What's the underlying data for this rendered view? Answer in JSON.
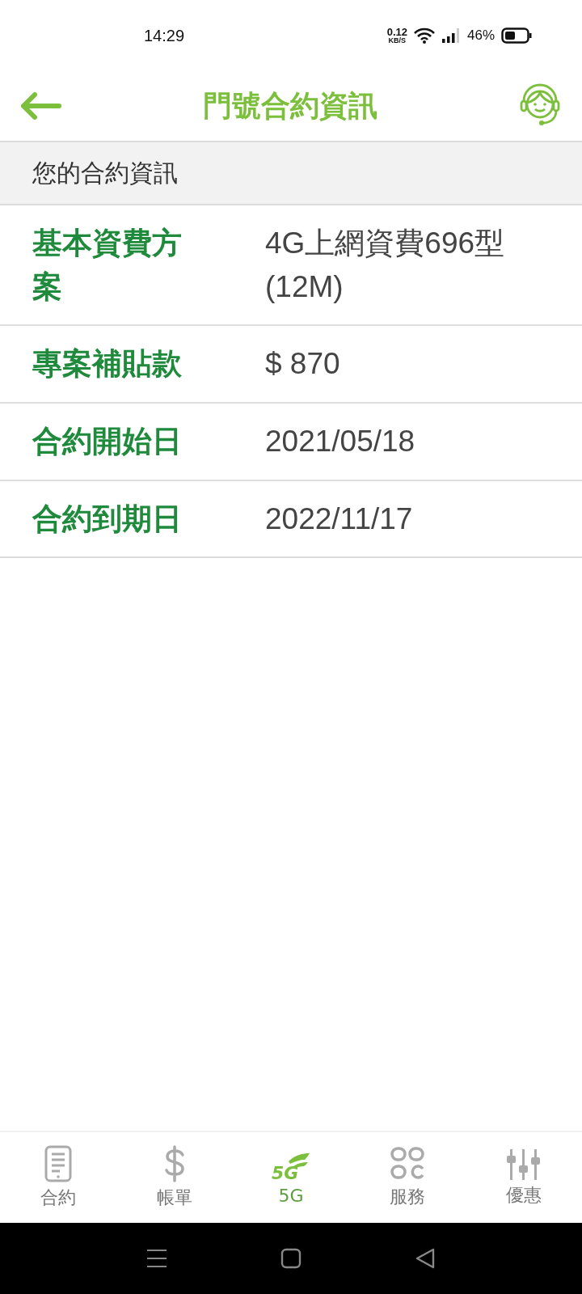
{
  "status_bar": {
    "time": "14:29",
    "net_speed": "0.12",
    "net_unit": "KB/S",
    "battery": "46%"
  },
  "header": {
    "title": "門號合約資訊"
  },
  "section": {
    "title": "您的合約資訊"
  },
  "rows": [
    {
      "label": "基本資費方案",
      "value": "4G上網資費696型(12M)"
    },
    {
      "label": "專案補貼款",
      "value": "$ 870"
    },
    {
      "label": "合約開始日",
      "value": "2021/05/18"
    },
    {
      "label": "合約到期日",
      "value": "2022/11/17"
    }
  ],
  "bottom_nav": [
    {
      "kind": "contract",
      "label": "合約",
      "selected": false
    },
    {
      "kind": "bill",
      "label": "帳單",
      "selected": false
    },
    {
      "kind": "network",
      "label": "5G",
      "logo": "5G",
      "selected": true
    },
    {
      "kind": "service",
      "label": "服務",
      "selected": false
    },
    {
      "kind": "offer",
      "label": "優惠",
      "selected": false
    }
  ]
}
